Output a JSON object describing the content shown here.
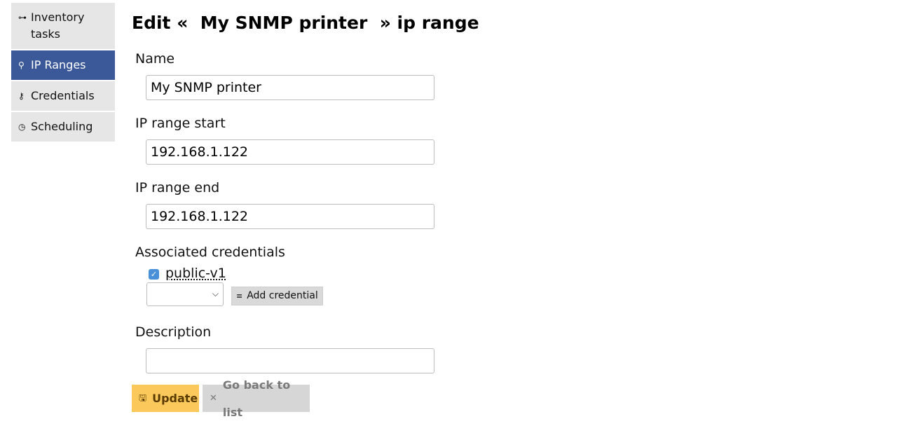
{
  "sidebar": {
    "items": [
      {
        "label": "Inventory tasks",
        "icon": "tree-icon",
        "active": false
      },
      {
        "label": "IP Ranges",
        "icon": "network-icon",
        "active": true
      },
      {
        "label": "Credentials",
        "icon": "key-icon",
        "active": false
      },
      {
        "label": "Scheduling",
        "icon": "clock-icon",
        "active": false
      }
    ]
  },
  "page": {
    "title": "Edit «  My SNMP printer  » ip range"
  },
  "form": {
    "name_label": "Name",
    "name_value": "My SNMP printer",
    "ip_start_label": "IP range start",
    "ip_start_value": "192.168.1.122",
    "ip_end_label": "IP range end",
    "ip_end_value": "192.168.1.122",
    "credentials_label": "Associated credentials",
    "credentials": [
      {
        "name": "public-v1",
        "checked": true
      }
    ],
    "credential_select_value": "",
    "add_credential_label": "Add credential",
    "description_label": "Description",
    "description_value": ""
  },
  "actions": {
    "update_label": "Update",
    "back_label": "Go back to list"
  },
  "colors": {
    "active_sidebar": "#3b5998",
    "update_button": "#fbc95b",
    "checkbox": "#4a90d9"
  }
}
